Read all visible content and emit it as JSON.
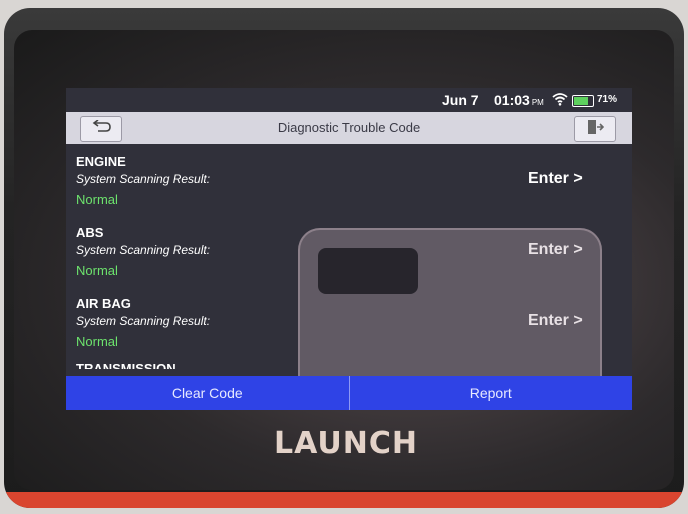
{
  "status": {
    "date": "Jun 7",
    "time": "01:03",
    "ampm": "PM",
    "battery": "71%",
    "battery_fraction": 0.71
  },
  "header": {
    "title": "Diagnostic Trouble Code",
    "back_icon": "back-return-icon",
    "exit_icon": "exit-door-icon"
  },
  "systems": [
    {
      "name": "ENGINE",
      "scan_label": "System Scanning Result:",
      "result": "Normal",
      "enter": "Enter >"
    },
    {
      "name": "ABS",
      "scan_label": "System Scanning Result:",
      "result": "Normal",
      "enter": "Enter >"
    },
    {
      "name": "AIR BAG",
      "scan_label": "System Scanning Result:",
      "result": "Normal",
      "enter": "Enter >"
    }
  ],
  "partial_system": "TRANSMISSION",
  "footer": {
    "clear_code": "Clear Code",
    "report": "Report"
  },
  "brand": "LAUNCH",
  "colors": {
    "accent_blue": "#2f43e6",
    "normal_green": "#6de36d",
    "device_orange": "#d9452f"
  }
}
